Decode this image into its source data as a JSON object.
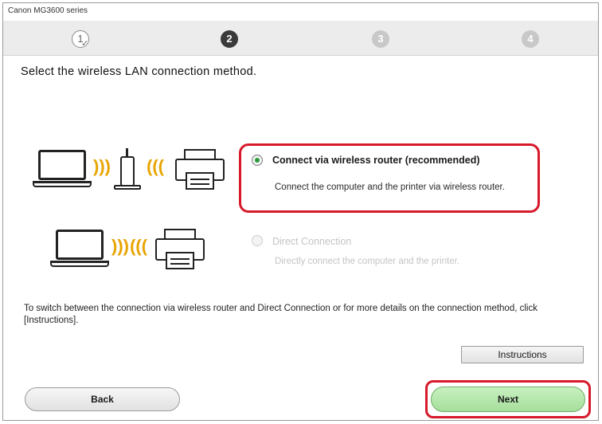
{
  "window": {
    "title": "Canon MG3600 series"
  },
  "steps": [
    {
      "label": "1",
      "state": "done"
    },
    {
      "label": "2",
      "state": "active"
    },
    {
      "label": "3",
      "state": "future"
    },
    {
      "label": "4",
      "state": "future"
    }
  ],
  "heading": "Select the wireless LAN connection method.",
  "options": [
    {
      "label": "Connect via wireless router (recommended)",
      "description": "Connect the computer and the printer via wireless router.",
      "selected": true,
      "enabled": true
    },
    {
      "label": "Direct Connection",
      "description": "Directly connect the computer and the printer.",
      "selected": false,
      "enabled": false
    }
  ],
  "info_text": "To switch between the connection via wireless router and Direct Connection or for more details on the connection method, click [Instructions].",
  "buttons": {
    "instructions": "Instructions",
    "back": "Back",
    "next": "Next"
  },
  "colors": {
    "highlight": "#d7192a",
    "radio_selected": "#2a9a3a",
    "next_button": "#b4e6aa",
    "wave": "#e8a400"
  }
}
